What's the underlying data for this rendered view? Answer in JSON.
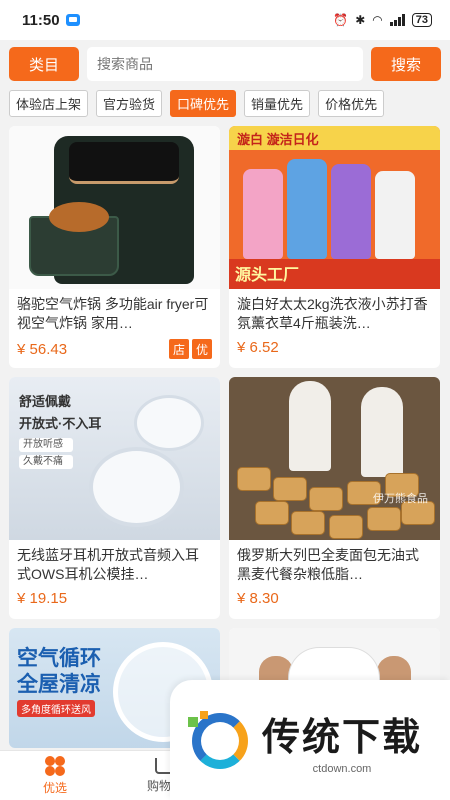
{
  "status_bar": {
    "time": "11:50",
    "battery": "73"
  },
  "search": {
    "category_label": "类目",
    "placeholder": "搜索商品",
    "search_label": "搜索"
  },
  "tabs": [
    {
      "label": "体验店上架",
      "active": false
    },
    {
      "label": "官方验货",
      "active": false
    },
    {
      "label": "口碑优先",
      "active": true
    },
    {
      "label": "销量优先",
      "active": false
    },
    {
      "label": "价格优先",
      "active": false
    }
  ],
  "products": [
    {
      "title": "骆驼空气炸锅 多功能air fryer可视空气炸锅 家用…",
      "price": "¥ 56.43",
      "badges": [
        "店",
        "优"
      ]
    },
    {
      "title": "漩白好太太2kg洗衣液小苏打香氛薰衣草4斤瓶装洗…",
      "price": "¥ 6.52",
      "badges": [],
      "image_text": {
        "banner": "漩白  漩洁日化",
        "footer": "源头工厂"
      }
    },
    {
      "title": "无线蓝牙耳机开放式音频入耳式OWS耳机公模挂…",
      "price": "¥ 19.15",
      "badges": [],
      "image_text": {
        "line1": "舒适佩戴",
        "line2": "开放式·不入耳",
        "tag1": "开放听感",
        "tag2": "久戴不痛"
      }
    },
    {
      "title": "俄罗斯大列巴全麦面包无油式黑麦代餐杂粮低脂…",
      "price": "¥ 8.30",
      "badges": [],
      "image_text": {
        "watermark": "伊万熊食品"
      }
    },
    {
      "title": "",
      "price": "",
      "badges": [],
      "image_text": {
        "headline": "空气循环\n全屋清凉",
        "sub": "多角度循环送风"
      }
    },
    {
      "title": "",
      "price": "",
      "badges": []
    }
  ],
  "bottom_nav": [
    {
      "label": "优选",
      "icon": "clover-icon",
      "active": true
    },
    {
      "label": "购物车",
      "icon": "cart-icon",
      "active": false
    }
  ],
  "overlay": {
    "title": "传统下载",
    "url": "ctdown.com"
  },
  "colors": {
    "accent": "#f5691b",
    "price": "#e9681a"
  }
}
